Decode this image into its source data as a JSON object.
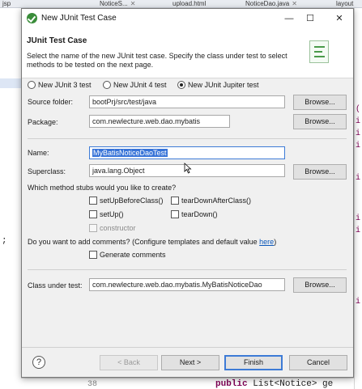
{
  "ide": {
    "tabs": [
      {
        "label": "jsp",
        "close": ""
      },
      {
        "label": "NoticeS...",
        "close": "✕"
      },
      {
        "label": "upload.html",
        "close": ""
      },
      {
        "label": "NoticeDao.java",
        "close": "✕"
      },
      {
        "label": "layout",
        "close": ""
      }
    ],
    "left_text": ";",
    "line_number": "38",
    "code_keyword": "public",
    "code_rest": " List<Notice> ge"
  },
  "dialog": {
    "title": "New JUnit Test Case",
    "header_title": "JUnit Test Case",
    "header_desc": "Select the name of the new JUnit test case. Specify the class under test to select methods to be tested on the next page.",
    "junit_options": [
      {
        "label": "New JUnit 3 test",
        "selected": false
      },
      {
        "label": "New JUnit 4 test",
        "selected": false
      },
      {
        "label": "New JUnit Jupiter test",
        "selected": true
      }
    ],
    "source_folder": {
      "label": "Source folder:",
      "value": "bootPrj/src/test/java"
    },
    "package": {
      "label": "Package:",
      "value": "com.newlecture.web.dao.mybatis"
    },
    "name": {
      "label": "Name:",
      "value": "MyBatisNoticeDaoTest"
    },
    "superclass": {
      "label": "Superclass:",
      "value": "java.lang.Object"
    },
    "browse_label": "Browse...",
    "stubs_question": "Which method stubs would you like to create?",
    "stubs": [
      {
        "label": "setUpBeforeClass()",
        "checked": false,
        "enabled": true
      },
      {
        "label": "tearDownAfterClass()",
        "checked": false,
        "enabled": true
      },
      {
        "label": "setUp()",
        "checked": false,
        "enabled": true
      },
      {
        "label": "tearDown()",
        "checked": false,
        "enabled": true
      },
      {
        "label": "constructor",
        "checked": false,
        "enabled": false
      }
    ],
    "comments_question": "Do you want to add comments? (Configure templates and default value ",
    "comments_link": "here",
    "comments_close": ")",
    "generate_comments": {
      "label": "Generate comments",
      "checked": false
    },
    "class_under_test": {
      "label": "Class under test:",
      "value": "com.newlecture.web.dao.mybatis.MyBatisNoticeDao"
    },
    "buttons": {
      "back": "< Back",
      "next": "Next >",
      "finish": "Finish",
      "cancel": "Cancel"
    },
    "window_controls": {
      "minimize": "—",
      "maximize": "☐",
      "close": "✕"
    },
    "help": "?"
  }
}
